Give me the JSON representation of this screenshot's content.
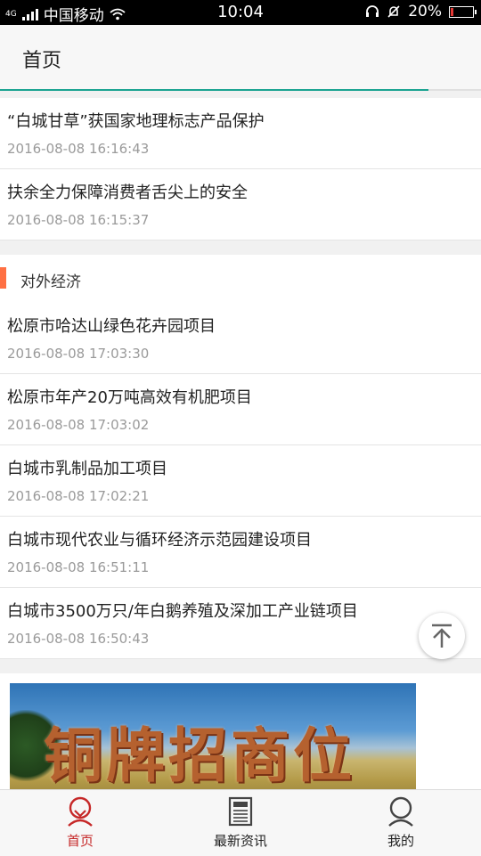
{
  "status_bar": {
    "network_label": "4G",
    "carrier": "中国移动",
    "time": "10:04",
    "battery_text": "20%",
    "battery_level": 0.2,
    "battery_color": "#e53935"
  },
  "app_bar": {
    "title": "首页",
    "load_progress": 0.89,
    "progress_color": "#1aa391"
  },
  "top_news": [
    {
      "title": "“白城甘草”获国家地理标志产品保护",
      "date": "2016-08-08 16:16:43"
    },
    {
      "title": "扶余全力保障消费者舌尖上的安全",
      "date": "2016-08-08 16:15:37"
    }
  ],
  "section": {
    "title": "对外经济",
    "accent_color": "#ff7043",
    "items": [
      {
        "title": "松原市哈达山绿色花卉园项目",
        "date": "2016-08-08 17:03:30"
      },
      {
        "title": "松原市年产20万吨高效有机肥项目",
        "date": "2016-08-08 17:03:02"
      },
      {
        "title": "白城市乳制品加工项目",
        "date": "2016-08-08 17:02:21"
      },
      {
        "title": "白城市现代农业与循环经济示范园建设项目",
        "date": "2016-08-08 16:51:11"
      },
      {
        "title": "白城市3500万只/年白鹅养殖及深加工产业链项目",
        "date": "2016-08-08 16:50:43"
      }
    ]
  },
  "banner": {
    "text": "铜牌招商位"
  },
  "back_to_top": {
    "icon": "arrow-up-to-top-icon"
  },
  "tab_bar": {
    "active_color": "#c62828",
    "tabs": [
      {
        "label": "首页",
        "icon": "home-icon",
        "active": true
      },
      {
        "label": "最新资讯",
        "icon": "newspaper-icon",
        "active": false
      },
      {
        "label": "我的",
        "icon": "profile-icon",
        "active": false
      }
    ]
  }
}
